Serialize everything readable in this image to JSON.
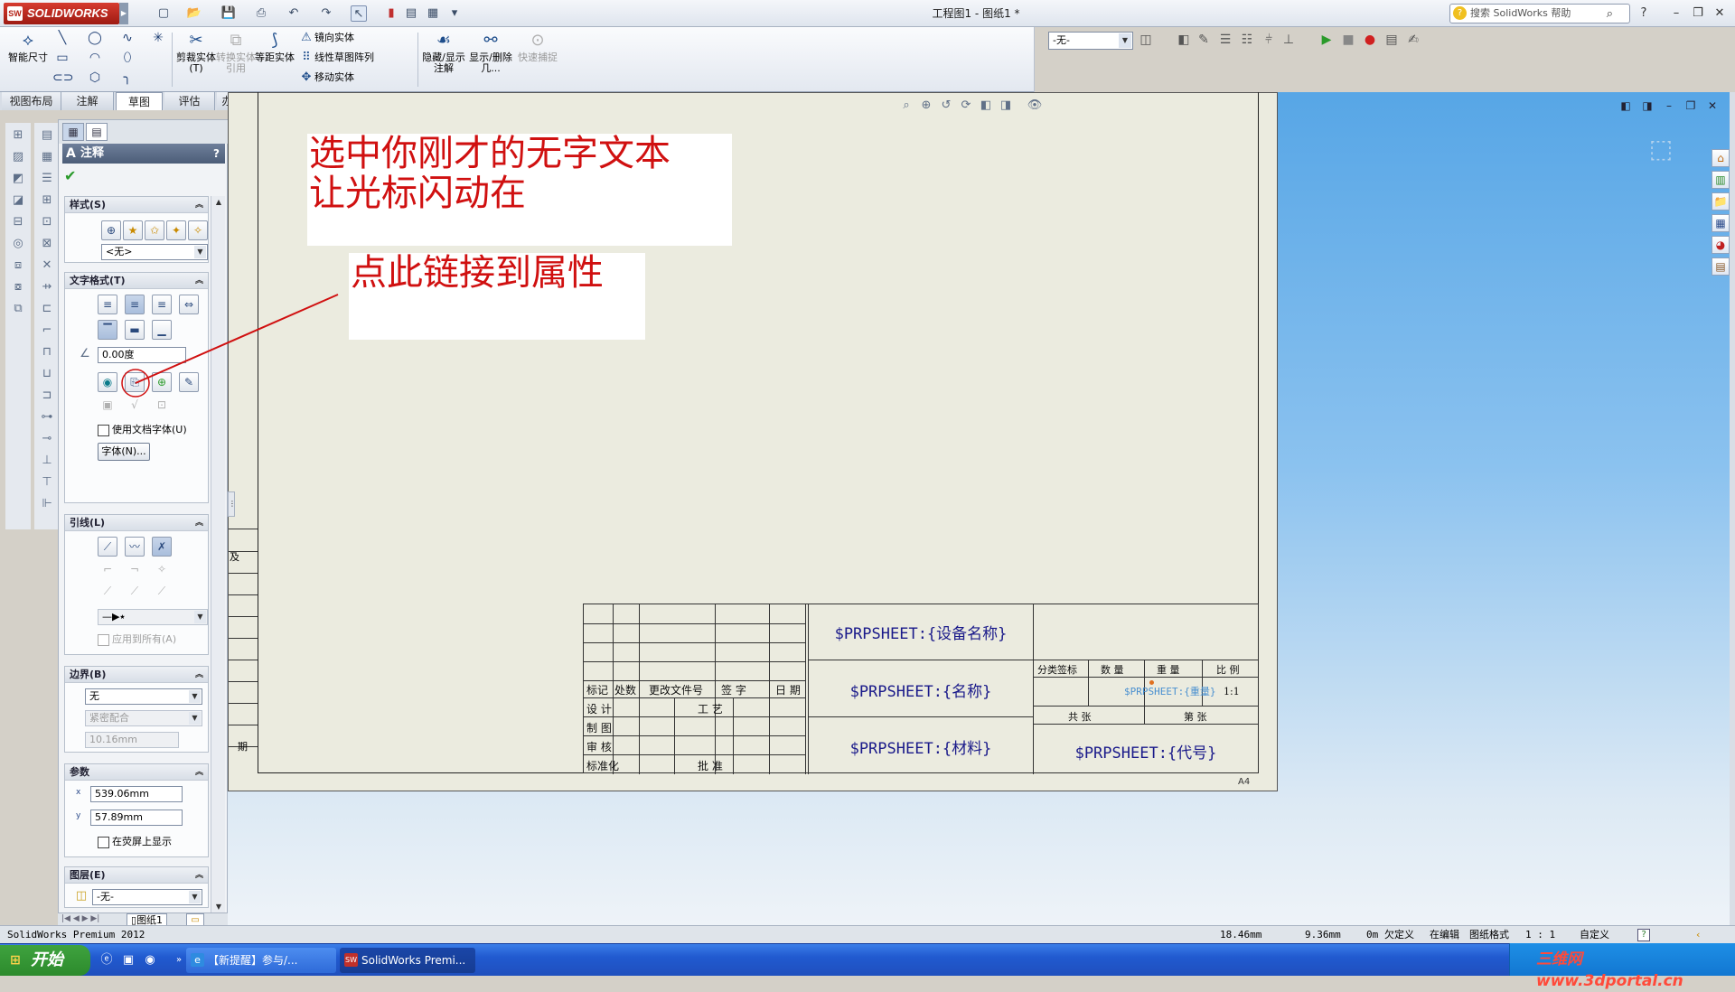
{
  "window": {
    "app_name": "SOLIDWORKS",
    "app_logo_text": "SW",
    "doc_title": "工程图1 - 图纸1 *",
    "help_search_placeholder": "搜索 SolidWorks 帮助"
  },
  "command_manager": {
    "smart_dimension": "智能尺寸",
    "trim_entities": "剪裁实体(T)",
    "convert_entities": "转换实体引用",
    "offset_entities": "等距实体",
    "mirror_entities": "镜向实体",
    "linear_pattern": "线性草图阵列",
    "move_entities": "移动实体",
    "hide_show_annotations": "隐藏/显示注解",
    "show_delete_relations": "显示/删除几...",
    "quick_snaps": "快速捕捉",
    "config_select": "-无-"
  },
  "tabs": [
    {
      "label": "视图布局",
      "active": false
    },
    {
      "label": "注解",
      "active": false
    },
    {
      "label": "草图",
      "active": true
    },
    {
      "label": "评估",
      "active": false
    },
    {
      "label": "办公室产品",
      "active": false
    }
  ],
  "property_manager": {
    "title": "注释",
    "help": "?",
    "style_group": {
      "header": "样式(S)",
      "style_select": "<无>"
    },
    "text_format_group": {
      "header": "文字格式(T)",
      "angle_value": "0.00度",
      "use_doc_font_label": "使用文档字体(U)",
      "font_button": "字体(N)..."
    },
    "leader_group": {
      "header": "引线(L)",
      "apply_all_label": "应用到所有(A)"
    },
    "border_group": {
      "header": "边界(B)",
      "style_select": "无",
      "size_select": "紧密配合",
      "padding_value": "10.16mm"
    },
    "parameters_group": {
      "header": "参数",
      "x_label": "x",
      "y_label": "y",
      "x_value": "539.06mm",
      "y_value": "57.89mm",
      "show_on_screen_label": "在荧屏上显示"
    },
    "layer_group": {
      "header": "图层(E)",
      "layer_select": "-无-"
    },
    "sheet_tab": "图纸1"
  },
  "drawing": {
    "note1_line1": "选中你刚才的无字文本",
    "note1_line2": "让光标闪动在",
    "note2": "点此链接到属性",
    "left_frame_label_a": "及",
    "left_frame_label_b": "期",
    "sheet_size": "A4",
    "title_block": {
      "device_name": "$PRPSHEET:{设备名称}",
      "name": "$PRPSHEET:{名称}",
      "material": "$PRPSHEET:{材料}",
      "code": "$PRPSHEET:{代号}",
      "weight_prop": "$PRPSHEET:{重量}",
      "scale_value": "1:1",
      "h_mark": "标记",
      "h_count": "处数",
      "h_change_doc": "更改文件号",
      "h_sign": "签 字",
      "h_date": "日 期",
      "design": "设 计",
      "drawing": "制 图",
      "review": "审 核",
      "standard": "标准化",
      "process": "工 艺",
      "approve": "批 准",
      "stage_mark": "分类签标",
      "quantity": "数 量",
      "weight": "重 量",
      "scale": "比 例",
      "total_sheets": "共 张",
      "sheet_no": "第 张"
    }
  },
  "status_bar": {
    "product": "SolidWorks Premium 2012",
    "x_coord": "18.46mm",
    "y_coord": "9.36mm",
    "z_coord": "0m",
    "defined": "欠定义",
    "editing": "在编辑",
    "editing_target": "图纸格式",
    "scale": "1 : 1",
    "custom": "自定义"
  },
  "taskbar": {
    "start_label": "开始",
    "task1": "【新提醒】参与/...",
    "task2": "SolidWorks Premi...",
    "watermark": "三维网www.3dportal.cn"
  }
}
